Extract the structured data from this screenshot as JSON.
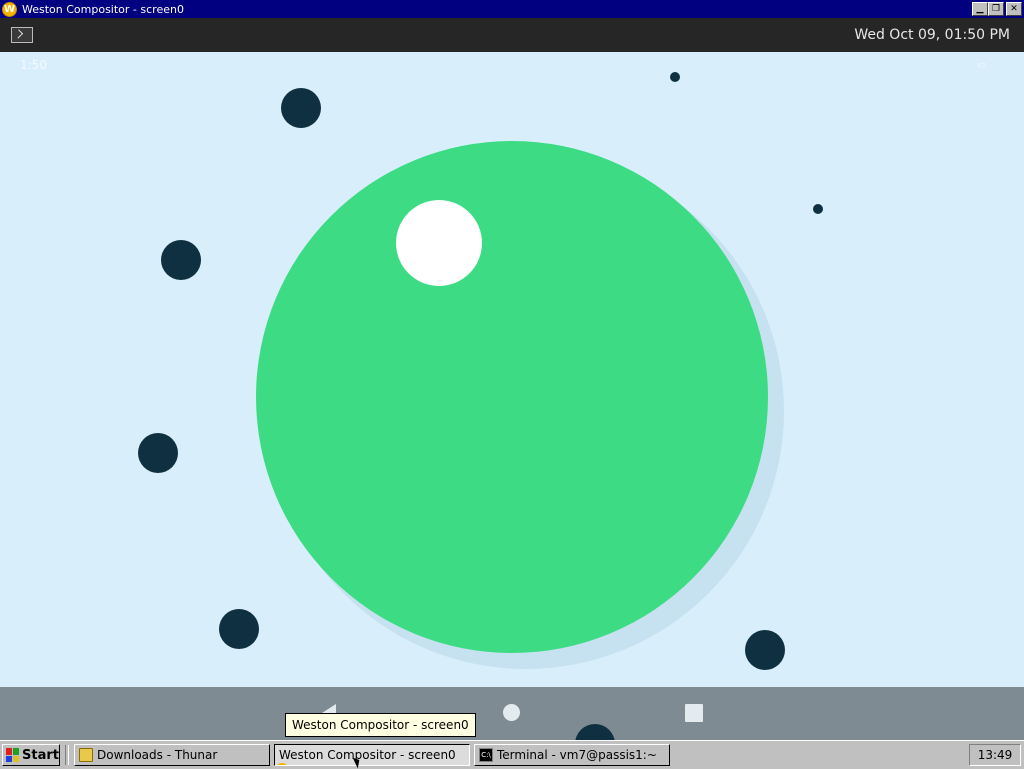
{
  "window": {
    "title": "Weston Compositor - screen0",
    "app_icon": "weston-icon",
    "controls": [
      "minimize-icon",
      "restore-icon",
      "close-icon"
    ]
  },
  "weston_panel": {
    "launcher_icon": "terminal-icon",
    "clock": "Wed Oct 09, 01:50 PM"
  },
  "android": {
    "status_time": "1:50",
    "status_icons": "battery-icon",
    "background_color": "#d8eefb",
    "accent_color": "#3ddc84",
    "dot_color": "#0f3040",
    "nav_buttons": [
      "back-icon",
      "home-icon",
      "recents-icon"
    ]
  },
  "tooltip": "Weston Compositor - screen0",
  "taskbar": {
    "start_label": "Start",
    "tasks": [
      {
        "label": "Downloads - Thunar",
        "icon": "folder-icon",
        "active": false
      },
      {
        "label": "Weston Compositor - screen0",
        "icon": "weston-icon",
        "active": true
      },
      {
        "label": "Terminal - vm7@passis1:~",
        "icon": "terminal-icon",
        "active": false
      }
    ],
    "clock": "13:49"
  }
}
